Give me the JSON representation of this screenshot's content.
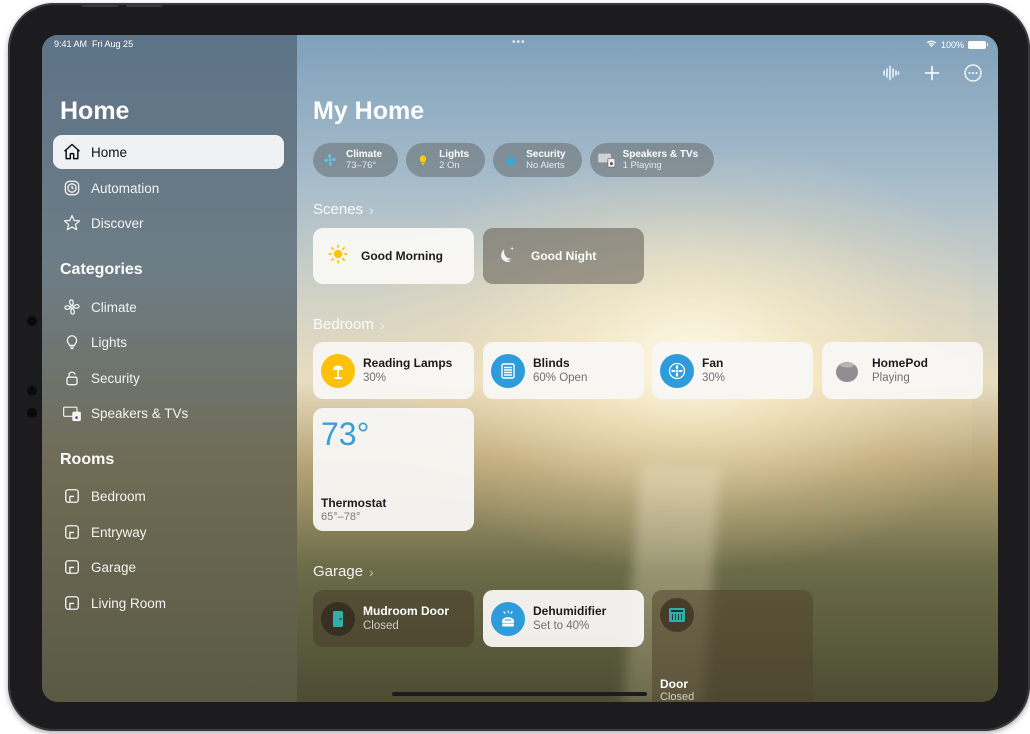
{
  "status": {
    "time": "9:41 AM",
    "date": "Fri Aug 25",
    "battery": "100%"
  },
  "sidebar": {
    "title": "Home",
    "items": [
      {
        "label": "Home",
        "icon": "house-icon",
        "active": true
      },
      {
        "label": "Automation",
        "icon": "clock-icon"
      },
      {
        "label": "Discover",
        "icon": "star-icon"
      }
    ],
    "categories_title": "Categories",
    "categories": [
      {
        "label": "Climate",
        "icon": "fan-icon"
      },
      {
        "label": "Lights",
        "icon": "lightbulb-icon"
      },
      {
        "label": "Security",
        "icon": "lock-icon"
      },
      {
        "label": "Speakers & TVs",
        "icon": "tv-speaker-icon"
      }
    ],
    "rooms_title": "Rooms",
    "rooms": [
      {
        "label": "Bedroom",
        "icon": "room-icon"
      },
      {
        "label": "Entryway",
        "icon": "room-icon"
      },
      {
        "label": "Garage",
        "icon": "room-icon"
      },
      {
        "label": "Living Room",
        "icon": "room-icon"
      }
    ]
  },
  "main": {
    "title": "My Home",
    "toolbar": {
      "siri": "waveform-icon",
      "add": "plus-icon",
      "more": "ellipsis-circle-icon"
    },
    "chips": [
      {
        "title": "Climate",
        "sub": "73–76°",
        "icon": "fan-icon",
        "color": "#5ac8fa"
      },
      {
        "title": "Lights",
        "sub": "2 On",
        "icon": "lightbulb-icon",
        "color": "#ffcc00"
      },
      {
        "title": "Security",
        "sub": "No Alerts",
        "icon": "lock-icon",
        "color": "#34aadc"
      },
      {
        "title": "Speakers & TVs",
        "sub": "1 Playing",
        "icon": "tv-speaker-icon",
        "color": "#d1d1d6"
      }
    ],
    "scenes_title": "Scenes",
    "scenes": [
      {
        "name": "Good Morning",
        "icon": "sun-icon"
      },
      {
        "name": "Good Night",
        "icon": "moon-icon"
      }
    ],
    "bedroom_title": "Bedroom",
    "bedroom": [
      {
        "name": "Reading Lamps",
        "status": "30%",
        "icon": "lamp-icon",
        "color": "#ffc107"
      },
      {
        "name": "Blinds",
        "status": "60% Open",
        "icon": "blinds-icon",
        "color": "#2e9bdb"
      },
      {
        "name": "Fan",
        "status": "30%",
        "icon": "fan-icon",
        "color": "#2e9bdb"
      },
      {
        "name": "HomePod",
        "status": "Playing",
        "icon": "homepod-icon",
        "color": "#8e8e93"
      }
    ],
    "thermostat": {
      "temp": "73°",
      "name": "Thermostat",
      "range": "65°–78°"
    },
    "garage_title": "Garage",
    "garage": [
      {
        "name": "Mudroom Door",
        "status": "Closed",
        "icon": "door-icon"
      },
      {
        "name": "Dehumidifier",
        "status": "Set to 40%",
        "icon": "dehumidifier-icon",
        "color": "#2e9bdb"
      },
      {
        "name": "Door",
        "status": "Closed",
        "icon": "garage-door-icon"
      }
    ]
  }
}
